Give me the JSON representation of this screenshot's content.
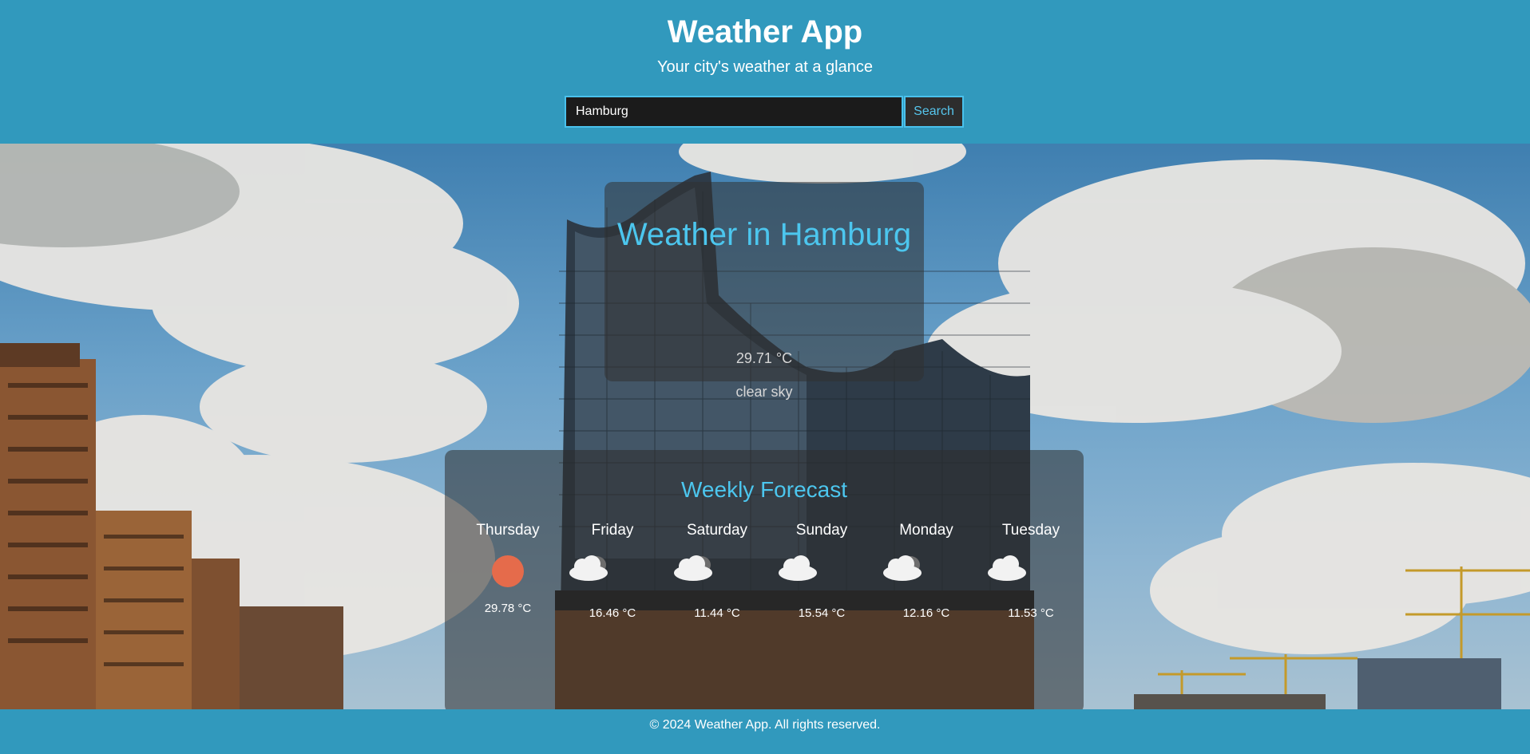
{
  "header": {
    "title": "Weather App",
    "subtitle": "Your city's weather at a glance"
  },
  "search": {
    "value": "Hamburg",
    "button_label": "Search"
  },
  "current": {
    "title": "Weather in Hamburg",
    "temperature": "29.71 °C",
    "description": "clear sky"
  },
  "forecast": {
    "title": "Weekly Forecast",
    "days": [
      {
        "name": "Thursday",
        "icon": "sun-icon",
        "temp": "29.78 °C"
      },
      {
        "name": "Friday",
        "icon": "cloud-icon",
        "temp": "16.46 °C"
      },
      {
        "name": "Saturday",
        "icon": "cloud-icon",
        "temp": "11.44 °C"
      },
      {
        "name": "Sunday",
        "icon": "cloud-icon",
        "temp": "15.54 °C"
      },
      {
        "name": "Monday",
        "icon": "cloud-icon",
        "temp": "12.16 °C"
      },
      {
        "name": "Tuesday",
        "icon": "cloud-icon",
        "temp": "11.53 °C"
      }
    ]
  },
  "footer": {
    "text": "© 2024 Weather App. All rights reserved."
  },
  "colors": {
    "header_bg": "#3199bd",
    "accent": "#4cc6ee",
    "sun": "#e56b4b"
  }
}
